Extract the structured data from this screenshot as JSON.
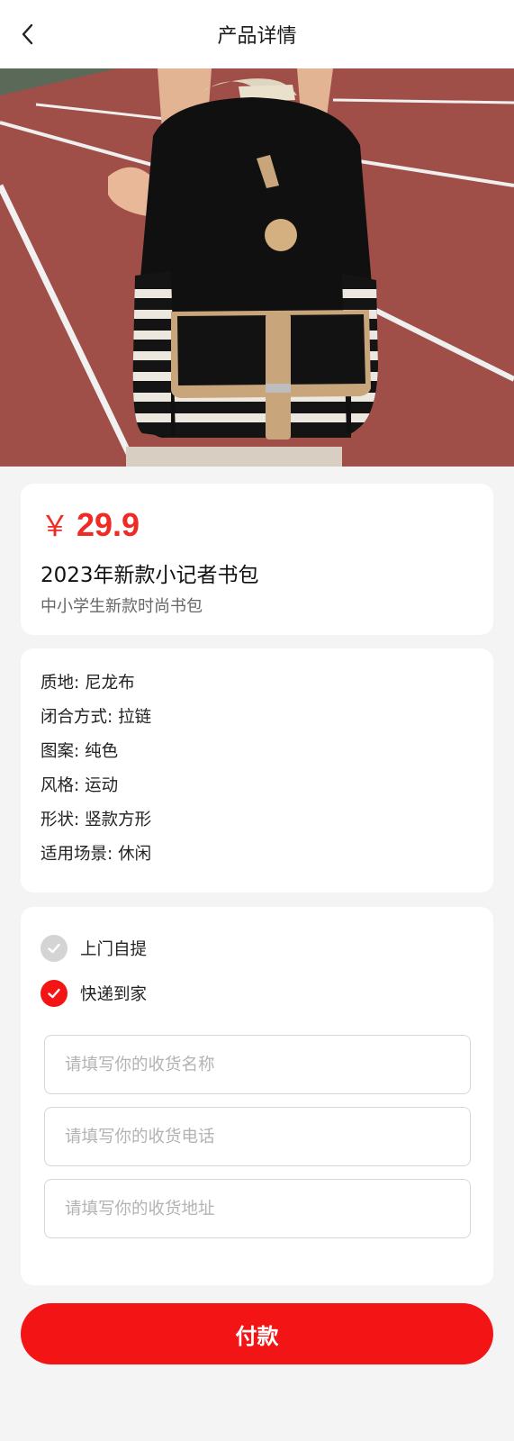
{
  "header": {
    "title": "产品详情",
    "back_icon": "chevron-left-icon"
  },
  "product": {
    "currency": "￥",
    "price": "29.9",
    "title": "2023年新款小记者书包",
    "subtitle": "中小学生新款时尚书包",
    "specs": [
      "质地: 尼龙布",
      "闭合方式: 拉链",
      "图案: 纯色",
      "风格: 运动",
      "形状: 竖款方形",
      "适用场景: 休闲"
    ]
  },
  "shipping": {
    "options": [
      {
        "label": "上门自提",
        "selected": false
      },
      {
        "label": "快递到家",
        "selected": true
      }
    ],
    "name_placeholder": "请填写你的收货名称",
    "phone_placeholder": "请填写你的收货电话",
    "address_placeholder": "请填写你的收货地址"
  },
  "pay_label": "付款",
  "colors": {
    "accent": "#f31515",
    "price": "#ee2b24",
    "check_off": "#d4d4d4",
    "page_bg": "#f4f4f4"
  }
}
